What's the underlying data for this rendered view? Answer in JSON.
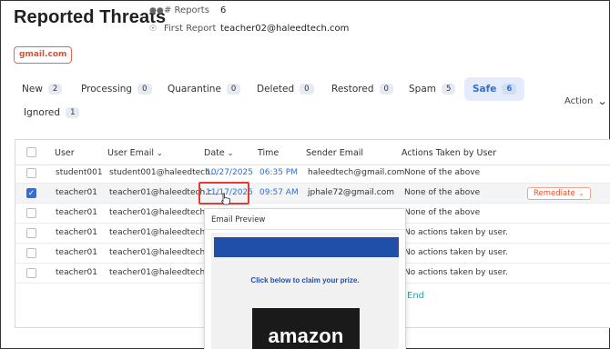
{
  "page": {
    "title": "Reported Threats",
    "reports_label": "# Reports",
    "reports_value": "6",
    "first_report_label": "First Report",
    "first_report_value": "teacher02@haleedtech.com",
    "domain_tag": "gmail.com"
  },
  "tabs": [
    {
      "label": "New",
      "count": "2"
    },
    {
      "label": "Processing",
      "count": "0"
    },
    {
      "label": "Quarantine",
      "count": "0"
    },
    {
      "label": "Deleted",
      "count": "0"
    },
    {
      "label": "Restored",
      "count": "0"
    },
    {
      "label": "Spam",
      "count": "5"
    },
    {
      "label": "Safe",
      "count": "6"
    },
    {
      "label": "Ignored",
      "count": "1"
    }
  ],
  "action_dropdown": "Action",
  "table": {
    "headers": {
      "user": "User",
      "user_email": "User Email",
      "date": "Date",
      "time": "Time",
      "sender_email": "Sender Email",
      "actions": "Actions Taken by User"
    },
    "rows": [
      {
        "user": "student001",
        "email": "student001@haleedtech...",
        "date": "10/27/2025",
        "time": "06:35 PM",
        "sender": "haleedtech@gmail.com",
        "action": "None of the above"
      },
      {
        "user": "teacher01",
        "email": "teacher01@haleedtech.c...",
        "date": "11/17/2025",
        "time": "09:57 AM",
        "sender": "jphale72@gmail.com",
        "action": "None of the above",
        "remediate": "Remediate"
      },
      {
        "user": "teacher01",
        "email": "teacher01@haleedtech.c...",
        "action": "None of the above"
      },
      {
        "user": "teacher01",
        "email": "teacher01@haleedtech.c...",
        "action": "No actions taken by user."
      },
      {
        "user": "teacher01",
        "email": "teacher01@haleedtech.c...",
        "action": "No actions taken by user."
      },
      {
        "user": "teacher01",
        "email": "teacher01@haleedtech.c...",
        "action": "No actions taken by user."
      }
    ],
    "end_text": "End"
  },
  "preview": {
    "title": "Email Preview",
    "claim_text": "Click below to claim your prize.",
    "brand": "amazon",
    "brand_bar_color": "#1f4fa8"
  },
  "colors": {
    "accent": "#2f6fd6",
    "warning": "#e0502f",
    "highlight": "#e63b2e"
  }
}
